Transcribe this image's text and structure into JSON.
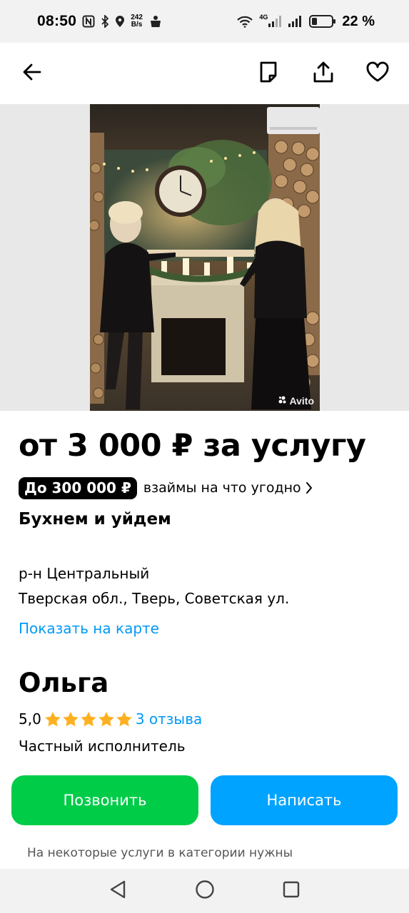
{
  "status_bar": {
    "time": "08:50",
    "net_speed_value": "242",
    "net_speed_unit": "B/s",
    "network_type": "4G",
    "battery_percent": "22 %"
  },
  "header": {
    "icons": [
      "back-arrow-icon",
      "note-icon",
      "share-icon",
      "heart-icon"
    ]
  },
  "gallery": {
    "watermark": "Avito"
  },
  "listing": {
    "price": "от 3 000 ₽ за услугу",
    "loan_chip": "До 300 000 ₽",
    "loan_text": "взаймы на что угодно",
    "title": "Бухнем и уйдем",
    "district": "р-н Центральный",
    "address": "Тверская обл., Тверь, Советская ул.",
    "map_link": "Показать на карте"
  },
  "seller": {
    "name": "Ольга",
    "rating": "5,0",
    "stars": 5,
    "reviews": "3 отзыва",
    "type": "Частный исполнитель"
  },
  "actions": {
    "call": "Позвонить",
    "write": "Написать"
  },
  "notice": "На некоторые услуги в категории нужны",
  "colors": {
    "call_button": "#00cc48",
    "write_button": "#00a3ff",
    "link": "#0099f7",
    "star": "#ffb021"
  }
}
